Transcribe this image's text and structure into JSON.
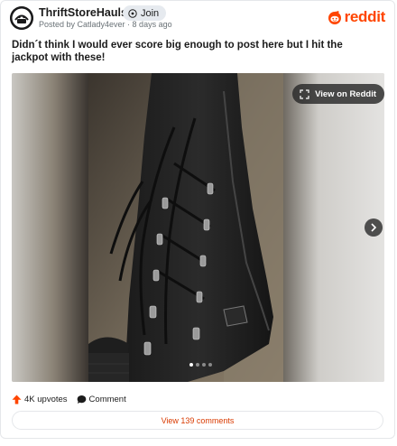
{
  "post": {
    "subreddit": "ThriftStoreHauls",
    "join_label": "Join",
    "posted_by": "Posted by Catlady4ever · 8 days ago",
    "title": "Didn´t think I would ever score big enough to post here but I hit the jackpot with these!",
    "brand": "reddit"
  },
  "media": {
    "view_on_reddit": "View on Reddit",
    "gallery_count": 4,
    "active_index": 1
  },
  "footer": {
    "upvotes": "4K upvotes",
    "comment_label": "Comment",
    "view_comments": "View 139 comments"
  },
  "colors": {
    "brand": "#ff4500",
    "upvote": "#ff4500",
    "link": "#d93a00"
  },
  "icons": [
    "subreddit-avatar-icon",
    "join-plus-icon",
    "reddit-snoo-icon",
    "expand-icon",
    "chevron-right-icon",
    "upvote-arrow-icon",
    "comment-bubble-icon"
  ]
}
